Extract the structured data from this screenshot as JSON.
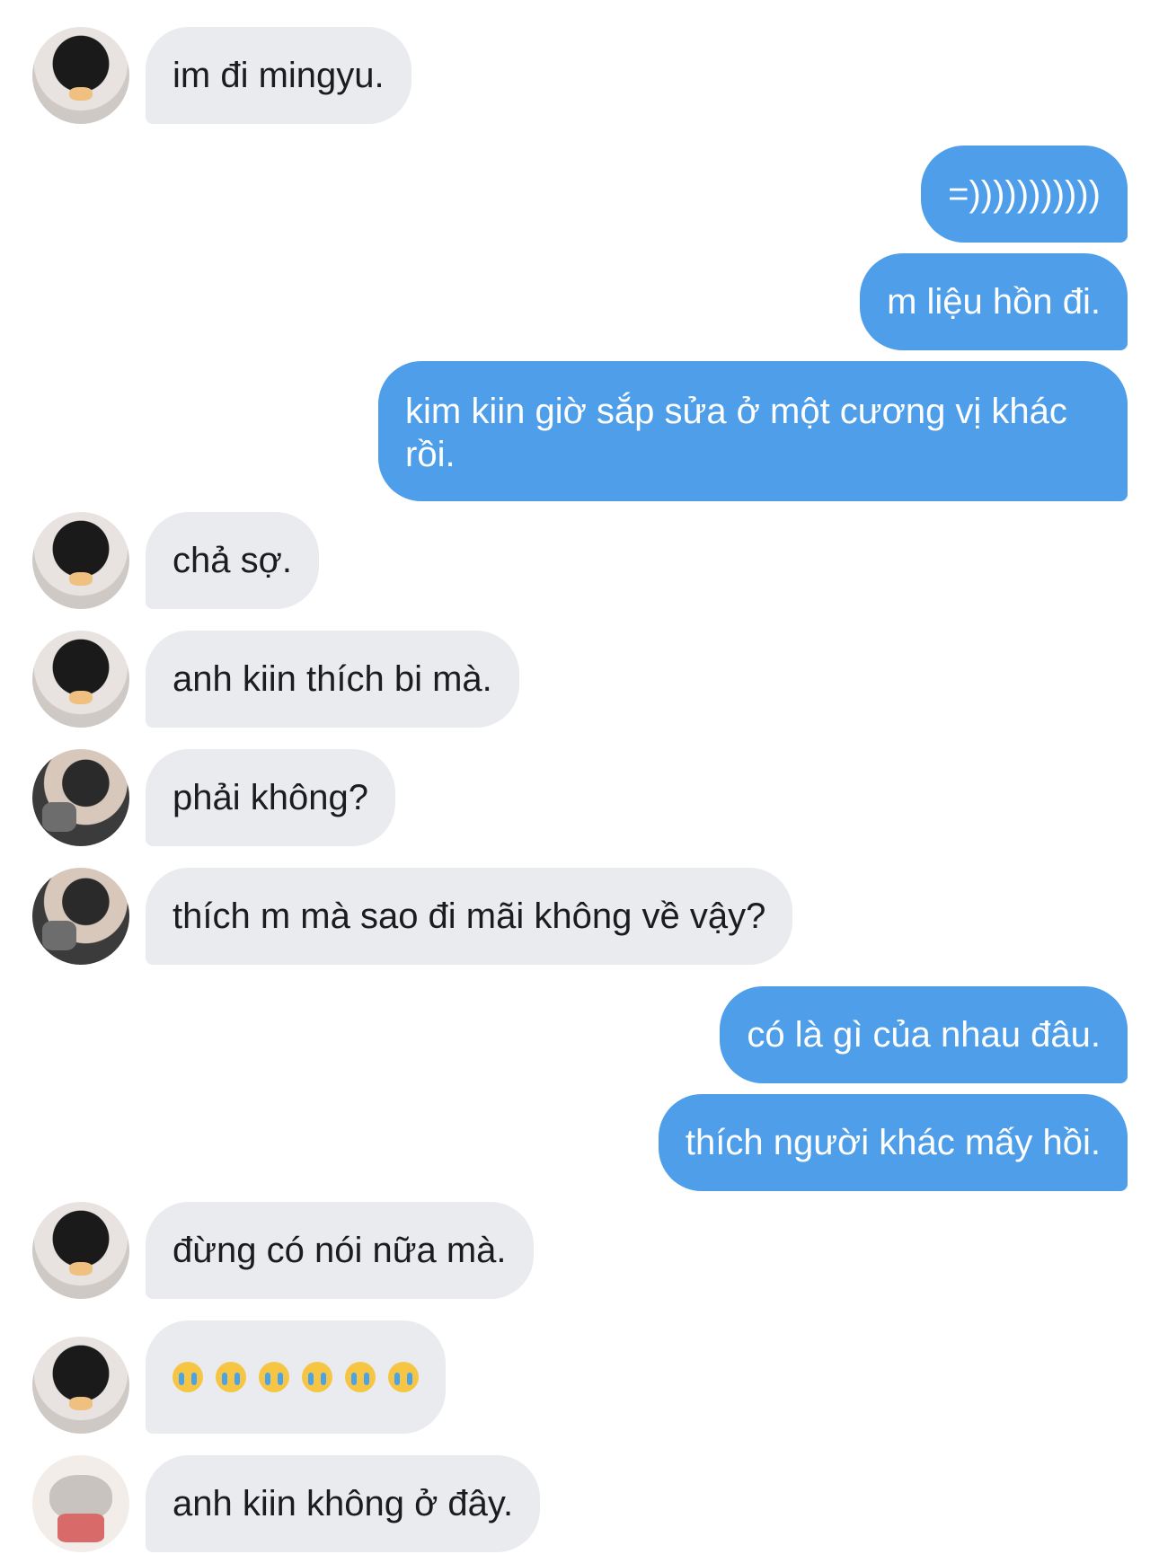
{
  "messages": [
    {
      "from": "them",
      "avatar": "avatar-a",
      "text": "im đi mingyu."
    },
    {
      "from": "me",
      "text": "=)))))))))))"
    },
    {
      "from": "me",
      "text": "m liệu hồn đi."
    },
    {
      "from": "me",
      "text": "kim kiin giờ sắp sửa ở một cương vị khác rồi."
    },
    {
      "from": "them",
      "avatar": "avatar-a",
      "text": "chả sợ."
    },
    {
      "from": "them",
      "avatar": "avatar-a",
      "text": "anh kiin thích bi mà."
    },
    {
      "from": "them",
      "avatar": "avatar-b",
      "text": "phải không?"
    },
    {
      "from": "them",
      "avatar": "avatar-b",
      "text": "thích m mà sao đi mãi không về vậy?"
    },
    {
      "from": "me",
      "text": "có là gì của nhau đâu."
    },
    {
      "from": "me",
      "text": "thích người khác mấy hồi."
    },
    {
      "from": "them",
      "avatar": "avatar-a",
      "text": "đừng có nói nữa mà."
    },
    {
      "from": "them",
      "avatar": "avatar-a",
      "emoji": "loudly-crying-face",
      "emoji_count": 6
    },
    {
      "from": "them",
      "avatar": "avatar-c",
      "text": "anh kiin không ở đây."
    }
  ],
  "colors": {
    "incoming_bubble": "#e9ebee",
    "outgoing_bubble": "#4e9eea",
    "incoming_text": "#1c1c1e",
    "outgoing_text": "#ffffff"
  }
}
